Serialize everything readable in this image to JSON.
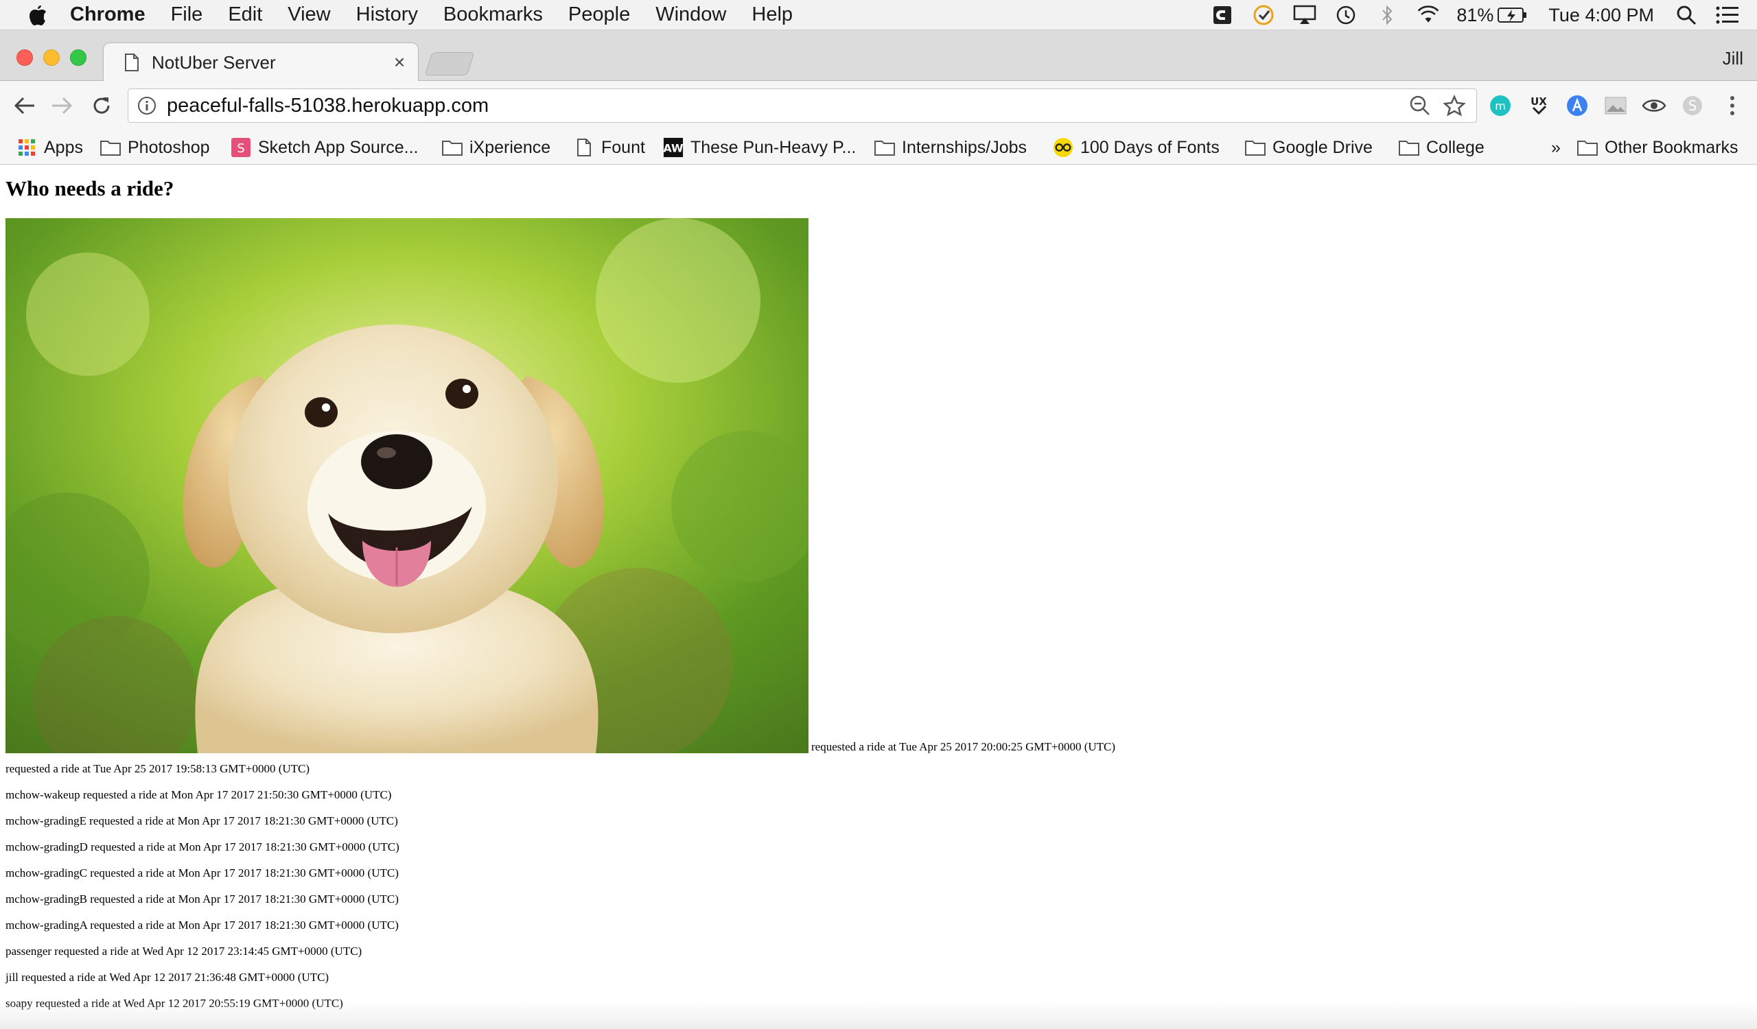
{
  "menubar": {
    "app_name": "Chrome",
    "items": [
      "File",
      "Edit",
      "View",
      "History",
      "Bookmarks",
      "People",
      "Window",
      "Help"
    ],
    "battery": "81%",
    "clock": "Tue 4:00 PM"
  },
  "tab": {
    "title": "NotUber Server",
    "close_glyph": "×"
  },
  "profile_name": "Jill",
  "address_bar": {
    "url": "peaceful-falls-51038.herokuapp.com"
  },
  "bookmarks": {
    "items": [
      {
        "label": "Apps",
        "icon": "apps-grid-icon"
      },
      {
        "label": "Photoshop",
        "icon": "folder-icon"
      },
      {
        "label": "Sketch App Source...",
        "icon": "sketch-favicon"
      },
      {
        "label": "iXperience",
        "icon": "folder-icon"
      },
      {
        "label": "Fount",
        "icon": "page-icon"
      },
      {
        "label": "These Pun-Heavy P...",
        "icon": "aw-favicon"
      },
      {
        "label": "Internships/Jobs",
        "icon": "folder-icon"
      },
      {
        "label": "100 Days of Fonts",
        "icon": "glasses-favicon"
      },
      {
        "label": "Google Drive",
        "icon": "folder-icon"
      },
      {
        "label": "College",
        "icon": "folder-icon"
      }
    ],
    "overflow": "»",
    "other": "Other Bookmarks"
  },
  "page": {
    "heading": "Who needs a ride?",
    "first_entry": "requested a ride at Tue Apr 25 2017 20:00:25 GMT+0000 (UTC)",
    "entries": [
      "requested a ride at Tue Apr 25 2017 19:58:13 GMT+0000 (UTC)",
      "mchow-wakeup requested a ride at Mon Apr 17 2017 21:50:30 GMT+0000 (UTC)",
      "mchow-gradingE requested a ride at Mon Apr 17 2017 18:21:30 GMT+0000 (UTC)",
      "mchow-gradingD requested a ride at Mon Apr 17 2017 18:21:30 GMT+0000 (UTC)",
      "mchow-gradingC requested a ride at Mon Apr 17 2017 18:21:30 GMT+0000 (UTC)",
      "mchow-gradingB requested a ride at Mon Apr 17 2017 18:21:30 GMT+0000 (UTC)",
      "mchow-gradingA requested a ride at Mon Apr 17 2017 18:21:30 GMT+0000 (UTC)",
      "passenger requested a ride at Wed Apr 12 2017 23:14:45 GMT+0000 (UTC)",
      "jill requested a ride at Wed Apr 12 2017 21:36:48 GMT+0000 (UTC)",
      "soapy requested a ride at Wed Apr 12 2017 20:55:19 GMT+0000 (UTC)"
    ]
  },
  "colors": {
    "traffic_red": "#fc5f57",
    "traffic_yellow": "#fdbc2e",
    "traffic_green": "#33c748",
    "menubar_bg": "#f2f2f2",
    "toolbar_bg": "#f6f6f6"
  }
}
